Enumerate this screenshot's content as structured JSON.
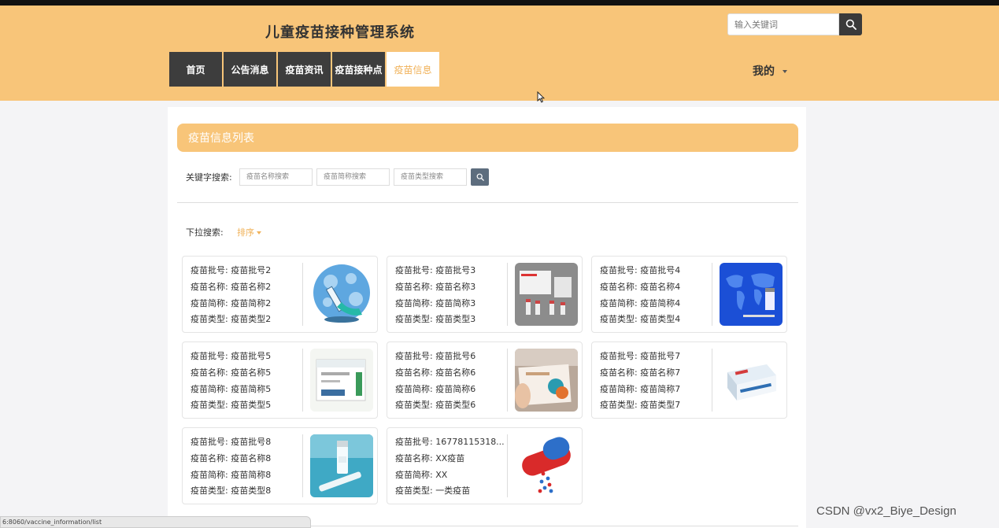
{
  "header": {
    "title": "儿童疫苗接种管理系统",
    "search_placeholder": "输入关键词",
    "nav": [
      {
        "label": "首页"
      },
      {
        "label": "公告消息"
      },
      {
        "label": "疫苗资讯"
      },
      {
        "label": "疫苗接种点"
      },
      {
        "label": "疫苗信息"
      }
    ],
    "active_nav": "疫苗信息",
    "user_menu_label": "我的"
  },
  "list": {
    "title": "疫苗信息列表",
    "keyword_label": "关键字搜索:",
    "filters": [
      {
        "placeholder": "疫苗名称搜索"
      },
      {
        "placeholder": "疫苗简称搜索"
      },
      {
        "placeholder": "疫苗类型搜索"
      }
    ],
    "dropdown_label": "下拉搜索:",
    "sort_label": "排序",
    "cards": [
      {
        "batch": "疫苗批号: 疫苗批号2",
        "name": "疫苗名称: 疫苗名称2",
        "abbr": "疫苗简称: 疫苗简称2",
        "type": "疫苗类型: 疫苗类型2",
        "image": "syringe-virus-image"
      },
      {
        "batch": "疫苗批号: 疫苗批号3",
        "name": "疫苗名称: 疫苗名称3",
        "abbr": "疫苗简称: 疫苗简称3",
        "type": "疫苗类型: 疫苗类型3",
        "image": "vaccine-box-vials-image"
      },
      {
        "batch": "疫苗批号: 疫苗批号4",
        "name": "疫苗名称: 疫苗名称4",
        "abbr": "疫苗简称: 疫苗简称4",
        "type": "疫苗类型: 疫苗类型4",
        "image": "world-map-vial-image"
      },
      {
        "batch": "疫苗批号: 疫苗批号5",
        "name": "疫苗名称: 疫苗名称5",
        "abbr": "疫苗简称: 疫苗简称5",
        "type": "疫苗类型: 疫苗类型5",
        "image": "medicine-box-image"
      },
      {
        "batch": "疫苗批号: 疫苗批号6",
        "name": "疫苗名称: 疫苗名称6",
        "abbr": "疫苗简称: 疫苗简称6",
        "type": "疫苗类型: 疫苗类型6",
        "image": "hand-holding-box-image"
      },
      {
        "batch": "疫苗批号: 疫苗批号7",
        "name": "疫苗名称: 疫苗名称7",
        "abbr": "疫苗简称: 疫苗简称7",
        "type": "疫苗类型: 疫苗类型7",
        "image": "blister-pack-box-image"
      },
      {
        "batch": "疫苗批号: 疫苗批号8",
        "name": "疫苗名称: 疫苗名称8",
        "abbr": "疫苗简称: 疫苗简称8",
        "type": "疫苗类型: 疫苗类型8",
        "image": "vial-syringe-image"
      },
      {
        "batch": "疫苗批号: 16778115318...",
        "name": "疫苗名称: XX疫苗",
        "abbr": "疫苗简称: XX",
        "type": "疫苗类型: 一类疫苗",
        "image": "capsule-pill-image"
      }
    ]
  },
  "status_url": "6:8060/vaccine_information/list",
  "watermark": "CSDN @vx2_Biye_Design",
  "colors": {
    "header_bg": "#f8c579",
    "accent": "#f0b25a",
    "nav_bg": "#3d3d3d",
    "page_bg": "#f4f4f6"
  }
}
